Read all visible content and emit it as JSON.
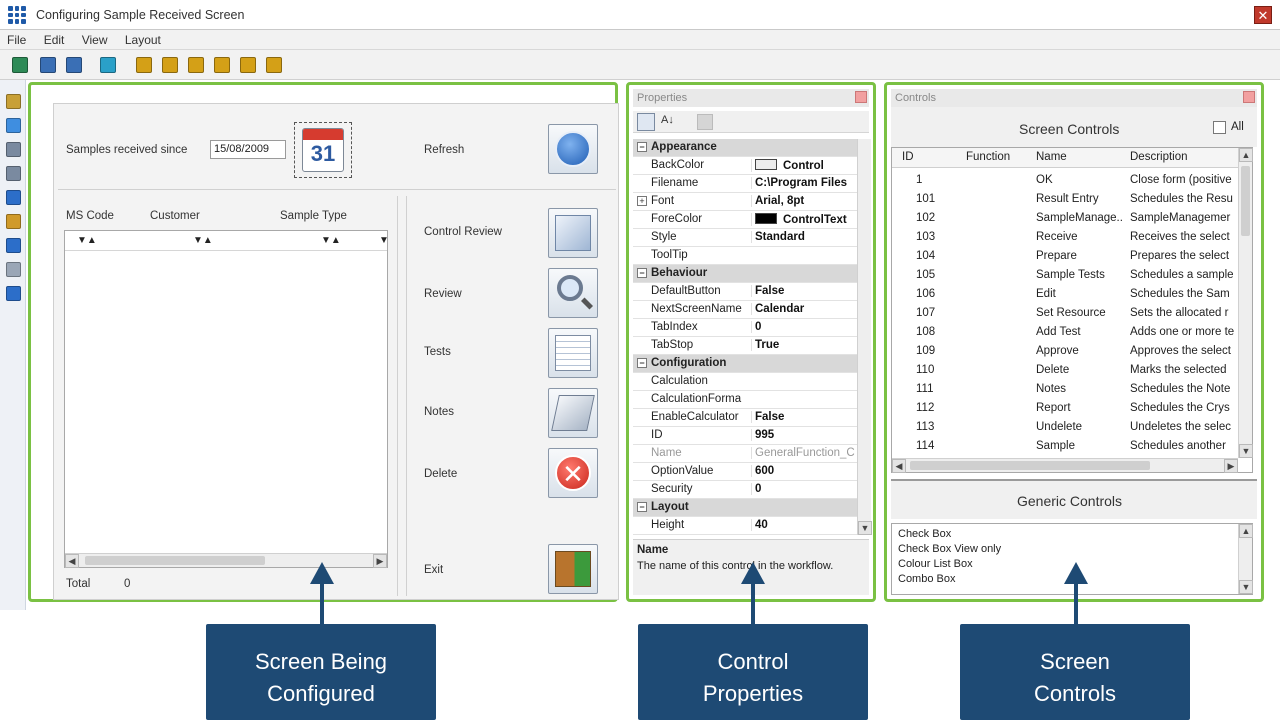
{
  "window": {
    "title": "Configuring Sample Received Screen",
    "close_glyph": "✕"
  },
  "menu": [
    "File",
    "Edit",
    "View",
    "Layout"
  ],
  "toolbar_icons": [
    {
      "name": "refresh-icon",
      "color": "#2e8b57"
    },
    {
      "name": "save-icon",
      "color": "#3a6fb5"
    },
    {
      "name": "load-icon",
      "color": "#3a6fb5"
    },
    {
      "name": "edit-layout-icon",
      "color": "#2aa0c8"
    },
    {
      "name": "align-left-icon",
      "color": "#d4a017"
    },
    {
      "name": "align-top-icon",
      "color": "#d4a017"
    },
    {
      "name": "align-bottom-icon",
      "color": "#d4a017"
    },
    {
      "name": "align-right-icon",
      "color": "#d4a017"
    },
    {
      "name": "same-height-icon",
      "color": "#d4a017"
    },
    {
      "name": "same-width-icon",
      "color": "#d4a017"
    }
  ],
  "left_toolbar_icons": [
    {
      "name": "pointer-icon",
      "color": "#c8a037"
    },
    {
      "name": "textbox-icon",
      "color": "#3f8ee0"
    },
    {
      "name": "form-icon",
      "color": "#7a8aa0"
    },
    {
      "name": "list-icon",
      "color": "#7a8aa0"
    },
    {
      "name": "shield-icon",
      "color": "#2c6ec9"
    },
    {
      "name": "grid-icon",
      "color": "#d09a2a"
    },
    {
      "name": "group-icon",
      "color": "#2c6ec9"
    },
    {
      "name": "page-icon",
      "color": "#9aa6b6"
    },
    {
      "name": "refresh-circle-icon",
      "color": "#2c6ec9"
    }
  ],
  "screen": {
    "samples_label": "Samples received since",
    "date_value": "15/08/2009",
    "calendar_day": "31",
    "refresh_label": "Refresh",
    "columns": [
      "MS Code",
      "Customer",
      "Sample Type"
    ],
    "sort_glyph": "▼▲",
    "total_label": "Total",
    "total_value": "0",
    "actions": [
      {
        "label": "Control Review",
        "name": "control-review-button"
      },
      {
        "label": "Review",
        "name": "review-button"
      },
      {
        "label": "Tests",
        "name": "tests-button"
      },
      {
        "label": "Notes",
        "name": "notes-button"
      },
      {
        "label": "Delete",
        "name": "delete-button"
      },
      {
        "label": "Exit",
        "name": "exit-button"
      }
    ]
  },
  "properties": {
    "title": "Properties",
    "rows": [
      {
        "type": "cat",
        "name": "Appearance"
      },
      {
        "name": "BackColor",
        "value": "Control",
        "swatch": "#ececec"
      },
      {
        "name": "Filename",
        "value": "C:\\Program Files"
      },
      {
        "name": "Font",
        "value": "Arial, 8pt",
        "expand": true
      },
      {
        "name": "ForeColor",
        "value": "ControlText",
        "swatch": "#000000"
      },
      {
        "name": "Style",
        "value": "Standard"
      },
      {
        "name": "ToolTip",
        "value": ""
      },
      {
        "type": "cat",
        "name": "Behaviour"
      },
      {
        "name": "DefaultButton",
        "value": "False"
      },
      {
        "name": "NextScreenName",
        "value": "Calendar"
      },
      {
        "name": "TabIndex",
        "value": "0"
      },
      {
        "name": "TabStop",
        "value": "True"
      },
      {
        "type": "cat",
        "name": "Configuration"
      },
      {
        "name": "Calculation",
        "value": ""
      },
      {
        "name": "CalculationForma",
        "value": ""
      },
      {
        "name": "EnableCalculator",
        "value": "False"
      },
      {
        "name": "ID",
        "value": "995"
      },
      {
        "name": "Name",
        "value": "GeneralFunction_C",
        "dim": true
      },
      {
        "name": "OptionValue",
        "value": "600"
      },
      {
        "name": "Security",
        "value": "0"
      },
      {
        "type": "cat",
        "name": "Layout"
      },
      {
        "name": "Height",
        "value": "40"
      }
    ],
    "desc_title": "Name",
    "desc_text": "The name of this control in the workflow."
  },
  "controls": {
    "title": "Controls",
    "screen_controls_title": "Screen Controls",
    "all_label": "All",
    "columns": [
      "ID",
      "Function",
      "Name",
      "Description"
    ],
    "rows": [
      {
        "id": "1",
        "name": "OK",
        "desc": "Close form (positive"
      },
      {
        "id": "101",
        "name": "Result Entry",
        "desc": "Schedules the Resu"
      },
      {
        "id": "102",
        "name": "SampleManage...",
        "desc": "SampleManagemer"
      },
      {
        "id": "103",
        "name": "Receive",
        "desc": "Receives the select"
      },
      {
        "id": "104",
        "name": "Prepare",
        "desc": "Prepares the select"
      },
      {
        "id": "105",
        "name": "Sample Tests",
        "desc": "Schedules a sample"
      },
      {
        "id": "106",
        "name": "Edit",
        "desc": "Schedules the Sam"
      },
      {
        "id": "107",
        "name": "Set Resource",
        "desc": "Sets the allocated r"
      },
      {
        "id": "108",
        "name": "Add Test",
        "desc": "Adds one or more te"
      },
      {
        "id": "109",
        "name": "Approve",
        "desc": "Approves the select"
      },
      {
        "id": "110",
        "name": "Delete",
        "desc": "Marks the selected"
      },
      {
        "id": "111",
        "name": "Notes",
        "desc": "Schedules the Note"
      },
      {
        "id": "112",
        "name": "Report",
        "desc": "Schedules the Crys"
      },
      {
        "id": "113",
        "name": "Undelete",
        "desc": "Undeletes the selec"
      },
      {
        "id": "114",
        "name": "Sample",
        "desc": "Schedules another"
      }
    ],
    "generic_title": "Generic Controls",
    "generic_items": [
      "Check Box",
      "Check Box View only",
      "Colour List Box",
      "Combo Box"
    ]
  },
  "callouts": [
    {
      "line1": "Screen Being",
      "line2": "Configured"
    },
    {
      "line1": "Control",
      "line2": "Properties"
    },
    {
      "line1": "Screen",
      "line2": "Controls"
    }
  ],
  "colors": {
    "frame_green": "#7ac143",
    "callout_blue": "#1e4a74"
  }
}
